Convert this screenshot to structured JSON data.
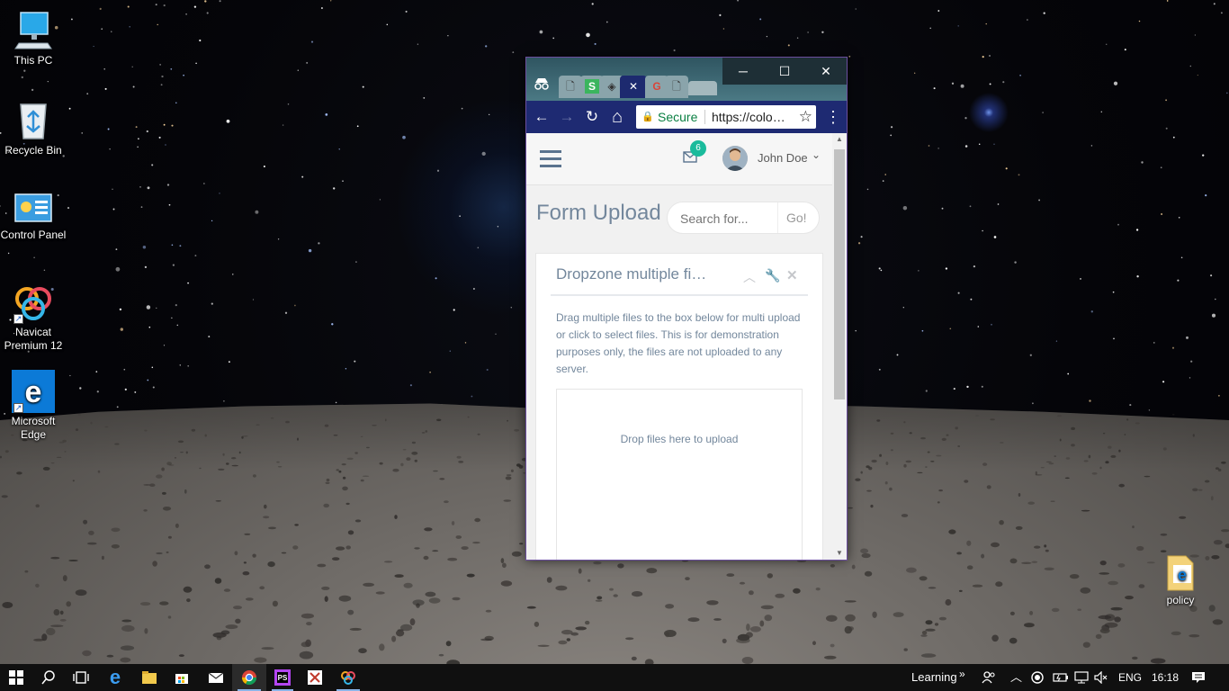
{
  "desktop": {
    "icons": [
      {
        "label": "This PC"
      },
      {
        "label": "Recycle Bin"
      },
      {
        "label": "Control Panel"
      },
      {
        "label": "Navicat Premium 12"
      },
      {
        "label": "Microsoft Edge"
      },
      {
        "label": "policy"
      }
    ]
  },
  "browser": {
    "window_controls": {
      "minimize": "─",
      "maximize": "☐",
      "close": "✕"
    },
    "tabs": [
      {
        "icon": "incognito-icon"
      },
      {
        "icon": "page-icon"
      },
      {
        "icon": "s-logo-icon",
        "glyph": "S"
      },
      {
        "icon": "codepen-icon"
      },
      {
        "icon": "close-tab-icon",
        "glyph": "✕"
      },
      {
        "icon": "google-icon",
        "glyph": "G"
      },
      {
        "icon": "page-icon"
      },
      {
        "icon": "new-tab-icon"
      }
    ],
    "toolbar": {
      "back": "←",
      "forward": "→",
      "reload": "↻",
      "home": "⌂",
      "secure_label": "Secure",
      "url": "https://colo…",
      "star": "☆",
      "menu": "⋮"
    }
  },
  "page": {
    "header": {
      "menu_icon": "hamburger-icon",
      "notification_count": "6",
      "user_name": "John Doe",
      "caret": "⌄"
    },
    "title": "Form Upload",
    "search": {
      "placeholder": "Search for...",
      "button": "Go!"
    },
    "panel": {
      "title": "Dropzone multiple fi…",
      "description": "Drag multiple files to the box below for multi upload or click to select files. This is for demonstration purposes only, the files are not uploaded to any server.",
      "dropzone_text": "Drop files here to upload"
    }
  },
  "taskbar": {
    "apps": [
      {
        "name": "start-icon"
      },
      {
        "name": "search-icon"
      },
      {
        "name": "task-view-icon"
      },
      {
        "name": "edge-icon"
      },
      {
        "name": "file-explorer-icon"
      },
      {
        "name": "store-icon"
      },
      {
        "name": "mail-icon"
      },
      {
        "name": "chrome-icon"
      },
      {
        "name": "phpstorm-icon"
      },
      {
        "name": "snipping-tool-icon"
      },
      {
        "name": "navicat-icon"
      }
    ],
    "tray": {
      "learning_label": "Learning",
      "chevron": "»",
      "language": "ENG",
      "time": "16:18"
    }
  }
}
